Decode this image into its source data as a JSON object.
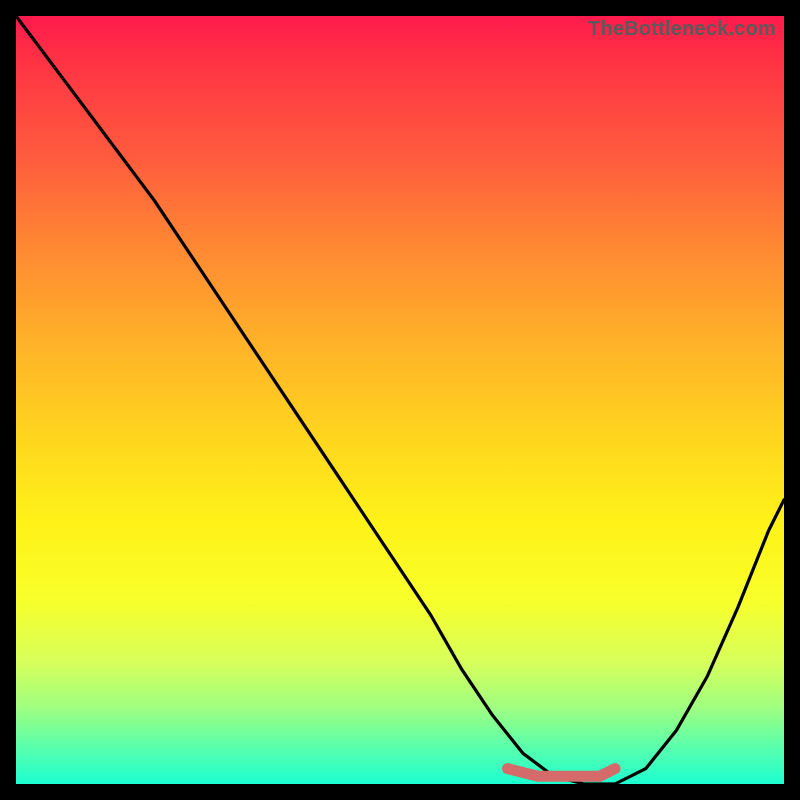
{
  "watermark": "TheBottleneck.com",
  "chart_data": {
    "type": "line",
    "title": "",
    "xlabel": "",
    "ylabel": "",
    "xlim": [
      0,
      100
    ],
    "ylim": [
      0,
      100
    ],
    "series": [
      {
        "name": "bottleneck-curve",
        "x": [
          0,
          6,
          12,
          18,
          24,
          30,
          36,
          42,
          48,
          54,
          58,
          62,
          66,
          70,
          74,
          78,
          82,
          86,
          90,
          94,
          98,
          100
        ],
        "values": [
          100,
          92,
          84,
          76,
          67,
          58,
          49,
          40,
          31,
          22,
          15,
          9,
          4,
          1,
          0,
          0,
          2,
          7,
          14,
          23,
          33,
          37
        ]
      },
      {
        "name": "optimal-zone",
        "x": [
          64,
          68,
          72,
          76,
          78
        ],
        "values": [
          2,
          1,
          1,
          1,
          2
        ]
      }
    ],
    "annotations": []
  },
  "colors": {
    "curve": "#000000",
    "optimal": "#d46a6a",
    "frame": "#000000"
  }
}
